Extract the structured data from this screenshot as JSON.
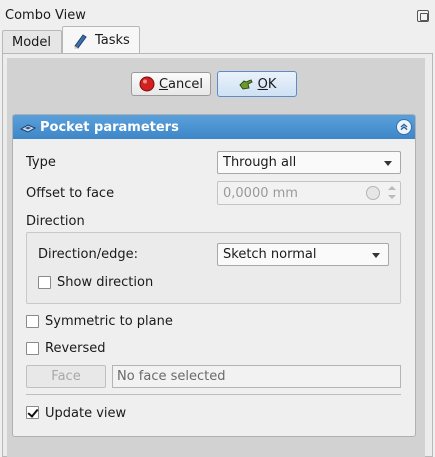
{
  "window": {
    "title": "Combo View"
  },
  "tabs": [
    {
      "label": "Model",
      "active": false
    },
    {
      "label": "Tasks",
      "active": true
    }
  ],
  "buttons": {
    "cancel": "Cancel",
    "ok": "OK"
  },
  "panel": {
    "title": "Pocket parameters",
    "type": {
      "label": "Type",
      "value": "Through all"
    },
    "offset": {
      "label": "Offset to face",
      "value": "0,0000 mm"
    },
    "direction": {
      "label": "Direction",
      "edge_label": "Direction/edge:",
      "edge_value": "Sketch normal",
      "show_direction": "Show direction"
    },
    "symmetric": "Symmetric to plane",
    "reversed": "Reversed",
    "face_button": "Face",
    "face_field": "No face selected",
    "update_view": "Update view"
  },
  "colors": {
    "header_blue": "#4a92d2",
    "cancel_red": "#d21f1f",
    "ok_green": "#6b9a2d"
  }
}
